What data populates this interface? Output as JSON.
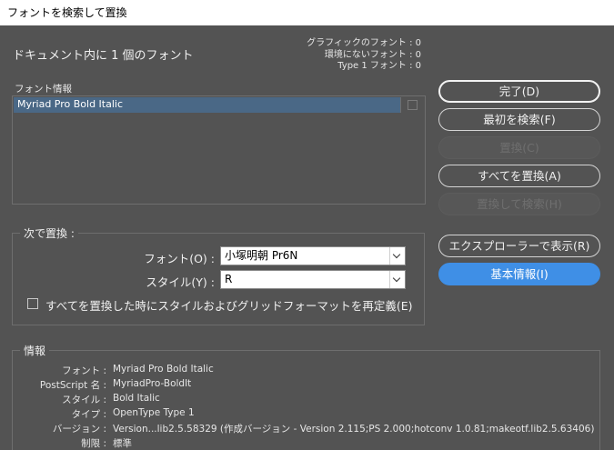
{
  "window": {
    "title": "フォントを検索して置換"
  },
  "summary": {
    "doc_fonts": "ドキュメント内に 1 個のフォント"
  },
  "stats": [
    "グラフィックのフォント : 0",
    "環境にないフォント : 0",
    "Type 1 フォント : 0"
  ],
  "font_list": {
    "label": "フォント情報",
    "items": [
      {
        "name": "Myriad Pro Bold Italic"
      }
    ]
  },
  "buttons": {
    "done": "完了(D)",
    "find_first": "最初を検索(F)",
    "replace": "置換(C)",
    "replace_all": "すべてを置換(A)",
    "replace_find": "置換して検索(H)",
    "reveal": "エクスプローラーで表示(R)",
    "basic_info": "基本情報(I)"
  },
  "replace_with": {
    "legend": "次で置換 :",
    "font_label": "フォント(O) :",
    "font_value": "小塚明朝  Pr6N",
    "style_label": "スタイル(Y) :",
    "style_value": "R",
    "redefine_label": "すべてを置換した時にスタイルおよびグリッドフォーマットを再定義(E)"
  },
  "info": {
    "legend": "情報",
    "rows": [
      {
        "key": "フォント :",
        "value": "Myriad Pro Bold Italic"
      },
      {
        "key": "PostScript 名 :",
        "value": "MyriadPro-BoldIt"
      },
      {
        "key": "スタイル :",
        "value": "Bold Italic"
      },
      {
        "key": "タイプ :",
        "value": "OpenType Type 1"
      },
      {
        "key": "バージョン :",
        "value": "Version...lib2.5.58329 (作成バージョン - Version 2.115;PS 2.000;hotconv 1.0.81;makeotf.lib2.5.63406)"
      },
      {
        "key": "制限 :",
        "value": "標準"
      }
    ]
  },
  "colors": {
    "background": "#535353",
    "selected_row": "#4a6886",
    "accent": "#3f8fe6"
  }
}
